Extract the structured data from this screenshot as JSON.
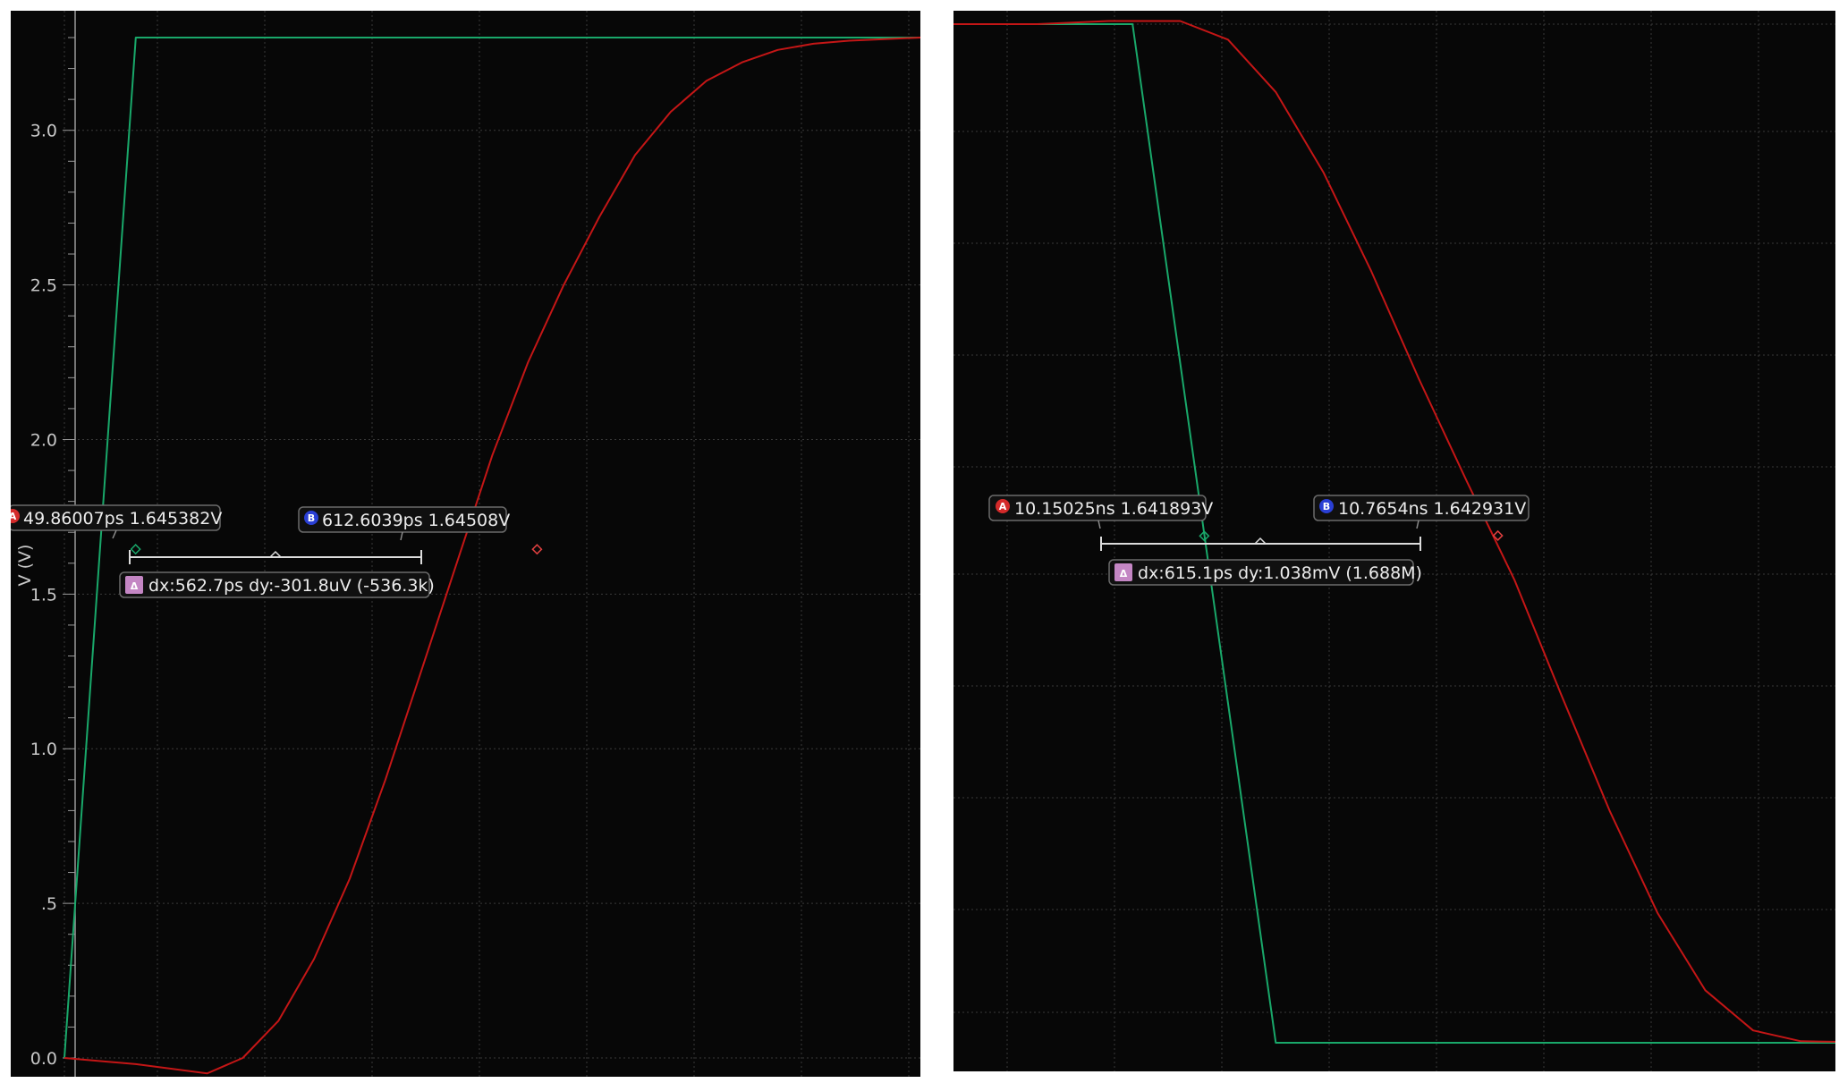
{
  "colors": {
    "background": "#070707",
    "grid": "#3a3a3a",
    "input_trace": "#19a86a",
    "output_trace": "#c41616",
    "marker_a": "#d42a2a",
    "marker_b": "#2a3fd4",
    "delta_badge": "#c486c4"
  },
  "chart_data": [
    {
      "type": "line",
      "xlabel": "",
      "ylabel": "V (V)",
      "ylim": [
        0.0,
        3.3
      ],
      "yticks": [
        "0.0",
        ".5",
        "1.0",
        "1.5",
        "2.0",
        "2.5",
        "3.0"
      ],
      "grid": true,
      "series": [
        {
          "color": "#19a86a",
          "points": [
            [
              -50,
              0.0
            ],
            [
              50,
              3.3
            ],
            [
              1150,
              3.3
            ]
          ]
        },
        {
          "color": "#c41616",
          "points": [
            [
              -50,
              0.0
            ],
            [
              50,
              -0.02
            ],
            [
              150,
              -0.05
            ],
            [
              200,
              0.0
            ],
            [
              250,
              0.12
            ],
            [
              300,
              0.32
            ],
            [
              350,
              0.58
            ],
            [
              400,
              0.9
            ],
            [
              450,
              1.25
            ],
            [
              500,
              1.6
            ],
            [
              550,
              1.95
            ],
            [
              600,
              2.25
            ],
            [
              650,
              2.5
            ],
            [
              700,
              2.72
            ],
            [
              750,
              2.92
            ],
            [
              800,
              3.06
            ],
            [
              850,
              3.16
            ],
            [
              900,
              3.22
            ],
            [
              950,
              3.26
            ],
            [
              1000,
              3.28
            ],
            [
              1050,
              3.29
            ],
            [
              1150,
              3.3
            ]
          ]
        }
      ],
      "markers": {
        "a": {
          "badge": "A",
          "label": "49.86007ps 1.645382V",
          "x": 49.86,
          "y": 1.645382
        },
        "b": {
          "badge": "B",
          "label": "612.6039ps 1.64508V",
          "x": 612.6,
          "y": 1.64508
        },
        "delta": {
          "badge": "Δ",
          "label": "dx:562.7ps dy:-301.8uV (-536.3k)"
        }
      }
    },
    {
      "type": "line",
      "xlabel": "",
      "ylabel": "",
      "ylim": [
        0.0,
        3.3
      ],
      "grid": true,
      "series": [
        {
          "color": "#19a86a",
          "points": [
            [
              9.4,
              3.3
            ],
            [
              10.0,
              3.3
            ],
            [
              10.3,
              0.0
            ],
            [
              11.6,
              0.0
            ]
          ]
        },
        {
          "color": "#c41616",
          "points": [
            [
              9.4,
              3.3
            ],
            [
              9.8,
              3.3
            ],
            [
              9.95,
              3.31
            ],
            [
              10.1,
              3.31
            ],
            [
              10.2,
              3.25
            ],
            [
              10.3,
              3.08
            ],
            [
              10.4,
              2.82
            ],
            [
              10.5,
              2.5
            ],
            [
              10.6,
              2.15
            ],
            [
              10.7,
              1.82
            ],
            [
              10.8,
              1.5
            ],
            [
              10.9,
              1.12
            ],
            [
              11.0,
              0.75
            ],
            [
              11.1,
              0.42
            ],
            [
              11.2,
              0.17
            ],
            [
              11.3,
              0.04
            ],
            [
              11.4,
              0.005
            ],
            [
              11.6,
              0.0
            ]
          ]
        }
      ],
      "markers": {
        "a": {
          "badge": "A",
          "label": "10.15025ns 1.641893V",
          "x": 10.15025,
          "y": 1.641893
        },
        "b": {
          "badge": "B",
          "label": "10.7654ns 1.642931V",
          "x": 10.7654,
          "y": 1.642931
        },
        "delta": {
          "badge": "Δ",
          "label": "dx:615.1ps dy:1.038mV (1.688M)"
        }
      }
    }
  ]
}
